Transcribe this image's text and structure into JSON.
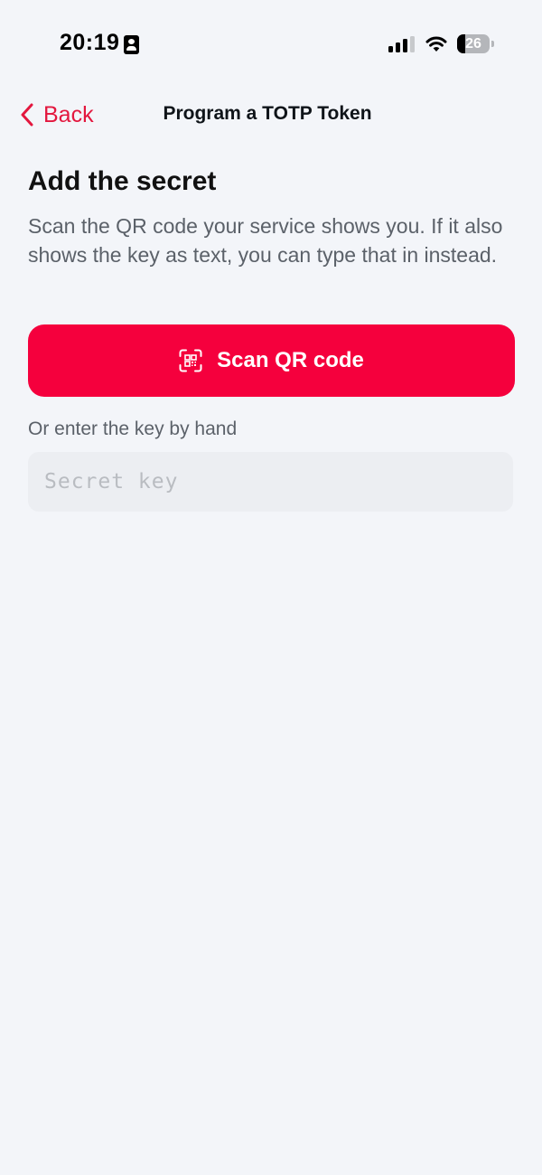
{
  "status_bar": {
    "time": "20:19",
    "battery_level": "26",
    "battery_percent": 26
  },
  "nav": {
    "back_label": "Back",
    "title": "Program a TOTP Token"
  },
  "content": {
    "section_title": "Add the secret",
    "description": "Scan the QR code your service shows you. If it also shows the key as text, you can type that in instead.",
    "scan_button_label": "Scan QR code",
    "manual_entry_label": "Or enter the key by hand",
    "secret_input": {
      "value": "",
      "placeholder": "Secret key"
    }
  },
  "colors": {
    "accent": "#f5003d",
    "link": "#e3173e",
    "background": "#f3f5f9",
    "input_background": "#eceef2",
    "secondary_text": "#5b6169"
  },
  "icons": {
    "status_person": "person-badge-icon",
    "signal": "cellular-signal-icon",
    "wifi": "wifi-icon",
    "battery": "battery-icon",
    "back": "chevron-left-icon",
    "scan": "qr-code-scan-icon"
  }
}
